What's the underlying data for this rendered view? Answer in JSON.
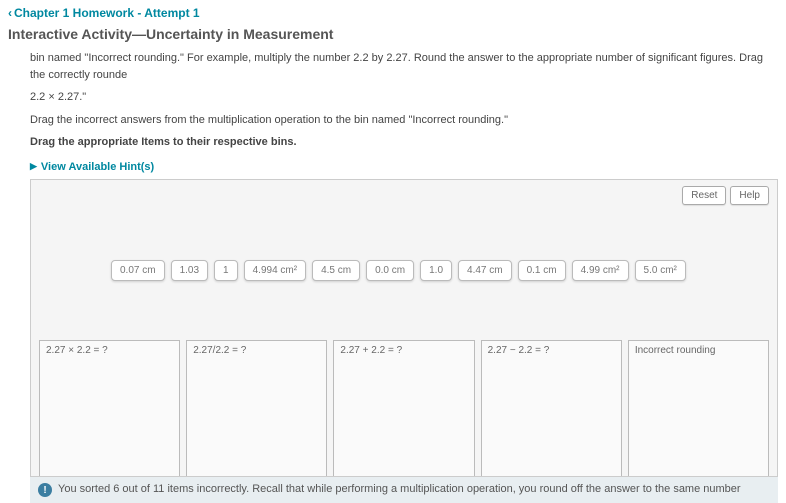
{
  "header": {
    "back_label": "Chapter 1 Homework - Attempt 1"
  },
  "title": "Interactive Activity—Uncertainty in Measurement",
  "instructions": {
    "p1": "bin named \"Incorrect rounding.\" For example, multiply the number 2.2 by 2.27. Round the answer to the appropriate number of significant figures. Drag the correctly rounde",
    "p2": "2.2 × 2.27.\"",
    "p3": "Drag the incorrect answers from the multiplication operation to the bin named \"Incorrect rounding.\"",
    "p4": "Drag the appropriate Items to their respective bins."
  },
  "hints_label": "View Available Hint(s)",
  "buttons": {
    "reset": "Reset",
    "help": "Help"
  },
  "chips": [
    "0.07 cm",
    "1.03",
    "1",
    "4.994 cm²",
    "4.5 cm",
    "0.0 cm",
    "1.0",
    "4.47 cm",
    "0.1 cm",
    "4.99 cm²",
    "5.0 cm²"
  ],
  "bins": [
    "2.27 × 2.2 = ?",
    "2.27/2.2 = ?",
    "2.27 + 2.2 = ?",
    "2.27 − 2.2 = ?",
    "Incorrect rounding"
  ],
  "feedback": "You sorted 6 out of 11 items incorrectly. Recall that while performing a multiplication operation, you round off the answer to the same number"
}
